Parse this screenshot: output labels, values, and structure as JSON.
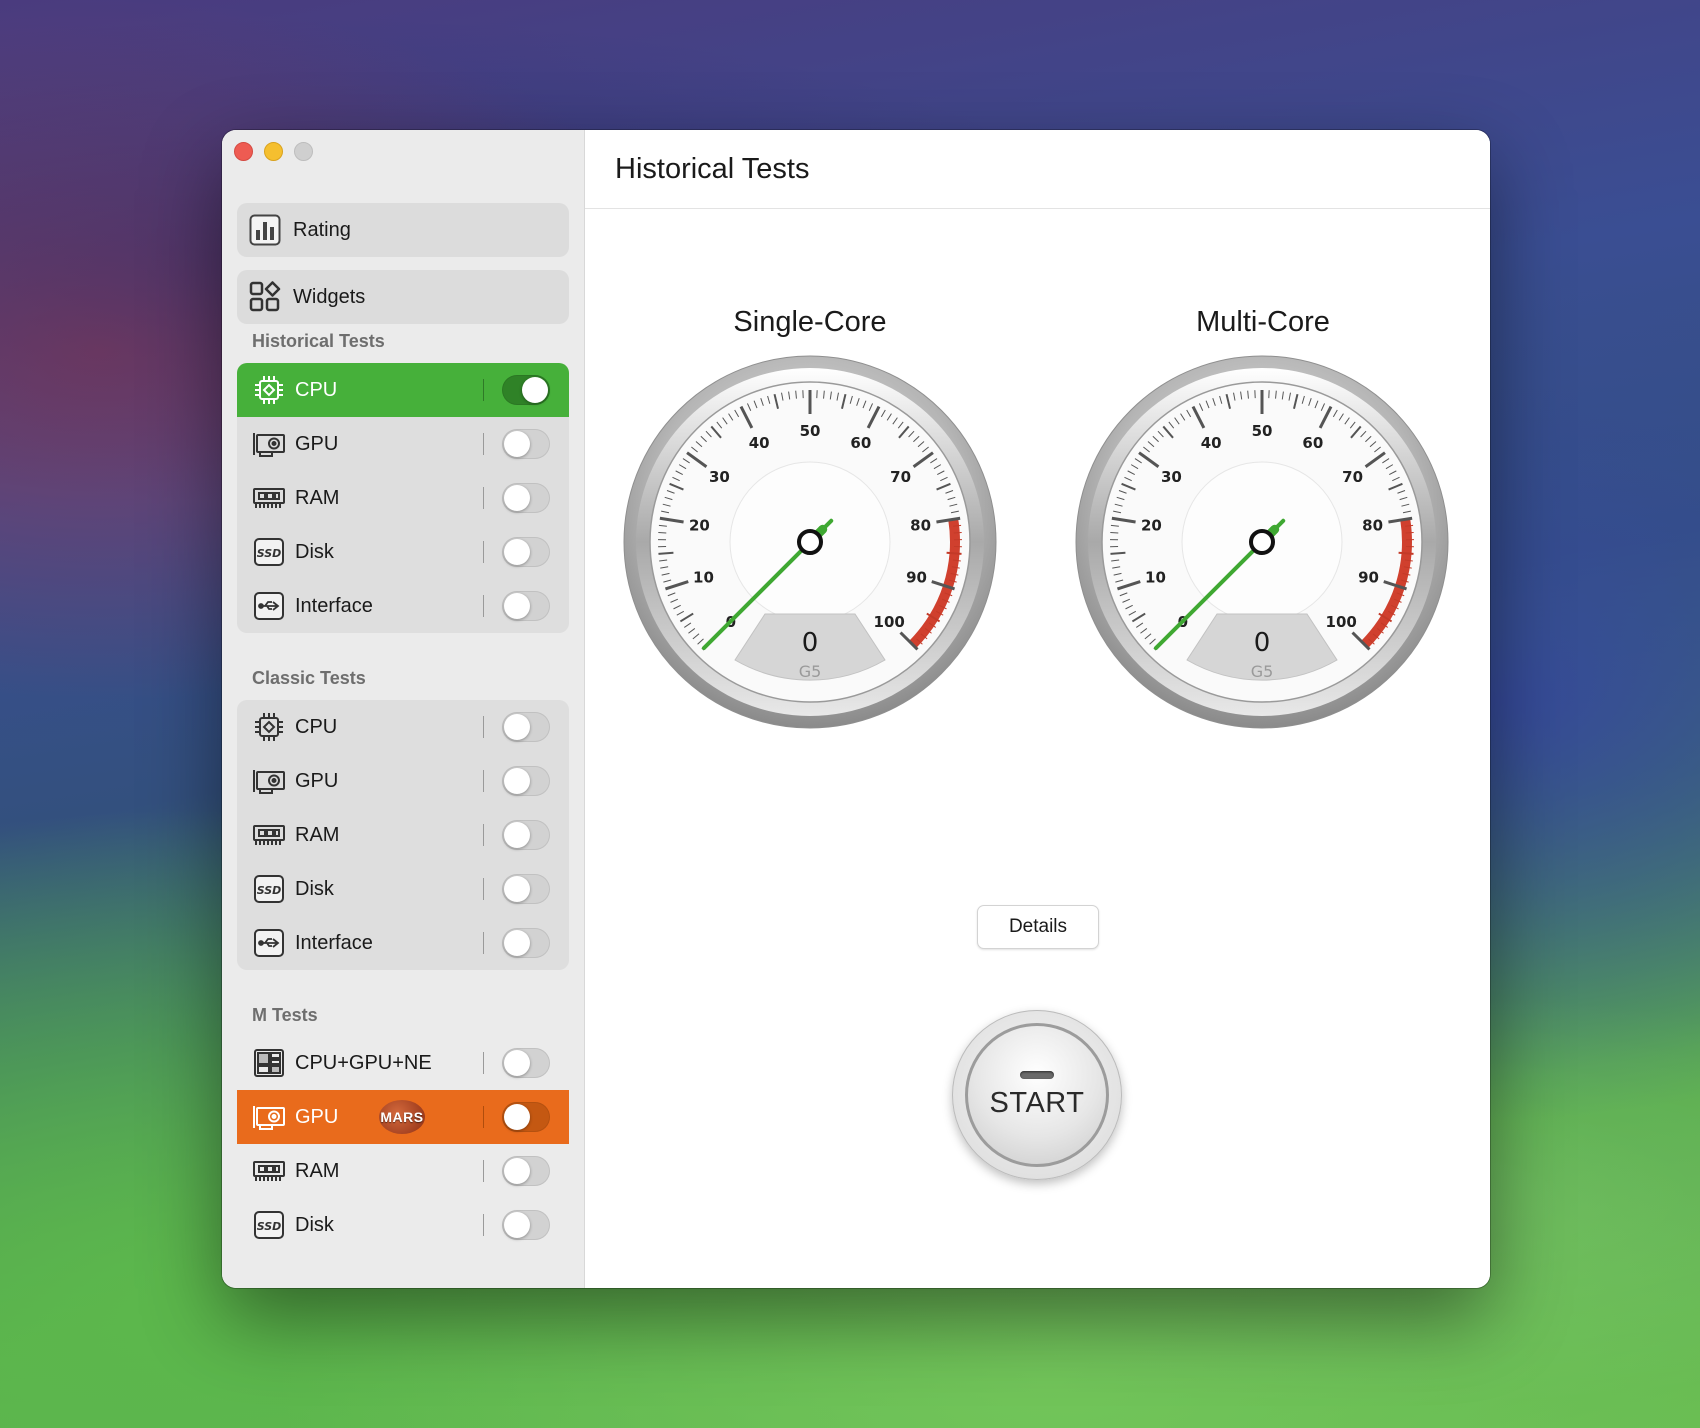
{
  "window": {
    "title": "Historical Tests"
  },
  "sidebar": {
    "nav": [
      {
        "label": "Rating",
        "icon": "bar-chart-icon"
      },
      {
        "label": "Widgets",
        "icon": "widgets-icon"
      }
    ],
    "sections": [
      {
        "title": "Historical Tests",
        "items": [
          {
            "label": "CPU",
            "icon": "cpu-chip-icon",
            "enabled": true
          },
          {
            "label": "GPU",
            "icon": "gpu-card-icon",
            "enabled": false
          },
          {
            "label": "RAM",
            "icon": "ram-stick-icon",
            "enabled": false
          },
          {
            "label": "Disk",
            "icon": "ssd-icon",
            "enabled": false
          },
          {
            "label": "Interface",
            "icon": "usb-icon",
            "enabled": false
          }
        ]
      },
      {
        "title": "Classic Tests",
        "items": [
          {
            "label": "CPU",
            "icon": "cpu-chip-icon",
            "enabled": false
          },
          {
            "label": "GPU",
            "icon": "gpu-card-icon",
            "enabled": false
          },
          {
            "label": "RAM",
            "icon": "ram-stick-icon",
            "enabled": false
          },
          {
            "label": "Disk",
            "icon": "ssd-icon",
            "enabled": false
          },
          {
            "label": "Interface",
            "icon": "usb-icon",
            "enabled": false
          }
        ]
      },
      {
        "title": "M Tests",
        "items": [
          {
            "label": "CPU+GPU+NE",
            "icon": "soc-icon",
            "enabled": false
          },
          {
            "label": "GPU",
            "icon": "gpu-card-icon",
            "enabled": false,
            "badge": "MARS",
            "highlight": "orange"
          },
          {
            "label": "RAM",
            "icon": "ram-stick-icon",
            "enabled": false
          },
          {
            "label": "Disk",
            "icon": "ssd-icon",
            "enabled": false
          }
        ]
      }
    ]
  },
  "gauges": [
    {
      "title": "Single-Core",
      "value": "0",
      "unit": "G5",
      "ticks": [
        "0",
        "10",
        "20",
        "30",
        "40",
        "50",
        "60",
        "70",
        "80",
        "90",
        "100"
      ]
    },
    {
      "title": "Multi-Core",
      "value": "0",
      "unit": "G5",
      "ticks": [
        "0",
        "10",
        "20",
        "30",
        "40",
        "50",
        "60",
        "70",
        "80",
        "90",
        "100"
      ]
    }
  ],
  "buttons": {
    "details": "Details",
    "start": "START"
  },
  "colors": {
    "accent_green": "#46b03a",
    "accent_orange": "#e96b1c",
    "needle": "#3fa832",
    "redzone": "#d0402e"
  }
}
